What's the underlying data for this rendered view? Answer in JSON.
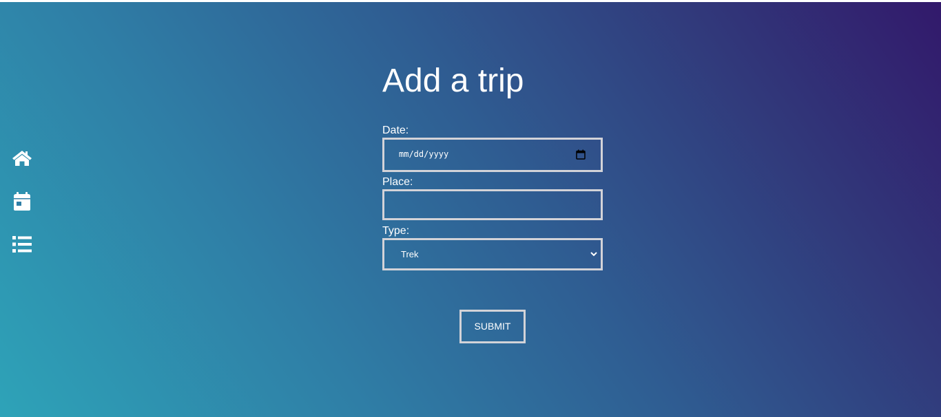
{
  "sidebar": {
    "items": [
      {
        "icon": "home-icon"
      },
      {
        "icon": "calendar-icon"
      },
      {
        "icon": "list-icon"
      }
    ]
  },
  "form": {
    "title": "Add a trip",
    "date": {
      "label": "Date:",
      "placeholder": "mm/dd/yyyy",
      "icon": "calendar-picker-icon"
    },
    "place": {
      "label": "Place:",
      "value": ""
    },
    "type": {
      "label": "Type:",
      "selected": "Trek",
      "icon": "chevron-down-icon"
    },
    "submit_label": "SUBMIT"
  },
  "colors": {
    "gradient_start": "#2ea3b8",
    "gradient_end": "#32196b",
    "text": "#ffffff",
    "border": "#d3d3d8"
  }
}
